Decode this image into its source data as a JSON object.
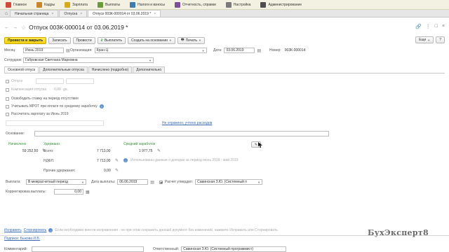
{
  "sections": [
    {
      "label": "Главное",
      "color": "#d04a3b"
    },
    {
      "label": "Кадры",
      "color": "#c9852a"
    },
    {
      "label": "Зарплата",
      "color": "#d8a81c"
    },
    {
      "label": "Выплаты",
      "color": "#6a9b3a"
    },
    {
      "label": "Налоги и взносы",
      "color": "#3f7ab5"
    },
    {
      "label": "Отчетность, справки",
      "color": "#7c4e9c"
    },
    {
      "label": "Настройка",
      "color": "#7a7a7a"
    },
    {
      "label": "Администрирование",
      "color": "#4e4e4e"
    }
  ],
  "window_tabs": [
    {
      "label": "Начальная страница"
    },
    {
      "label": "Отпуска"
    },
    {
      "label": "Отпуск 003К-000014 от 03.06.2019 *"
    }
  ],
  "title": "Отпуск 003К-000014 от 03.06.2019 *",
  "toolbar": {
    "post_close": "Провести и закрыть",
    "save": "Записать",
    "post": "Провести",
    "pay": "Выплатить",
    "create_based": "Создать на основании",
    "print": "Печать",
    "more": "Еще",
    "help": "?"
  },
  "header": {
    "month_label": "Месяц:",
    "month_value": "Июнь 2019",
    "org_label": "Организация:",
    "org_value": "Кран-Ц",
    "date_label": "Дата:",
    "date_value": "03.06.2019",
    "number_label": "Номер:",
    "number_value": "003К-000014",
    "employee_label": "Сотрудник:",
    "employee_value": "Габровская Светлана Марковна"
  },
  "subtabs": [
    {
      "label": "Основной отпуск"
    },
    {
      "label": "Дополнительные отпуска"
    },
    {
      "label": "Начислено (подробно)"
    },
    {
      "label": "Дополнительно"
    }
  ],
  "main": {
    "vacation_label": "Отпуск",
    "vacation_comp_label": "Компенсация отпуска",
    "vacation_comp_value": "0,00",
    "vacation_comp_unit": "дн.",
    "free_rate": "Освободить ставку на период отсутствия",
    "mrot": "Учитывать МРОТ при оплате по среднему заработку",
    "recalc": "Рассчитать зарплату за Июнь 2019",
    "hint_link": "Не отражено, учтено расходов",
    "basis_label": "Основание:"
  },
  "calc": {
    "accrued_label": "Начислено",
    "accrued_value": "59 252,50",
    "withheld_label": "Удержано",
    "total_label": "Всего:",
    "total_value": "7 713,00",
    "ndfl_label": "НДФЛ:",
    "ndfl_value": "7 713,00",
    "other_label": "Прочие удержания:",
    "other_value": "0,00",
    "avg_label": "Средний заработок",
    "avg_value": "1 977,75",
    "info_text": "Использованы данные о доходах за период июнь 2018 - май 2019"
  },
  "payment": {
    "label": "Выплата:",
    "value": "В межрасчетный период",
    "date_label": "Дата выплаты:",
    "date_value": "06.06.2019",
    "approved_label": "Расчет утвердил:",
    "approved_value": "Савинская З.Ю. (Системный п",
    "correction_label": "Корректировка выплаты:",
    "correction_value": "0,00"
  },
  "footer": {
    "fix": "Исправить",
    "reverse": "Сторнировать",
    "note": "Если необходимо внести исправления - не при этом сохранить данный документ без изменений, нажмите Исправить или Сторнировать",
    "signatures": "Подписи: Быкова И.В.",
    "comment_label": "Комментарий:",
    "responsible_label": "Ответственный:",
    "responsible_value": "Савинская З.Ю. (Системный программист)"
  },
  "logo": "БухЭксперт8"
}
